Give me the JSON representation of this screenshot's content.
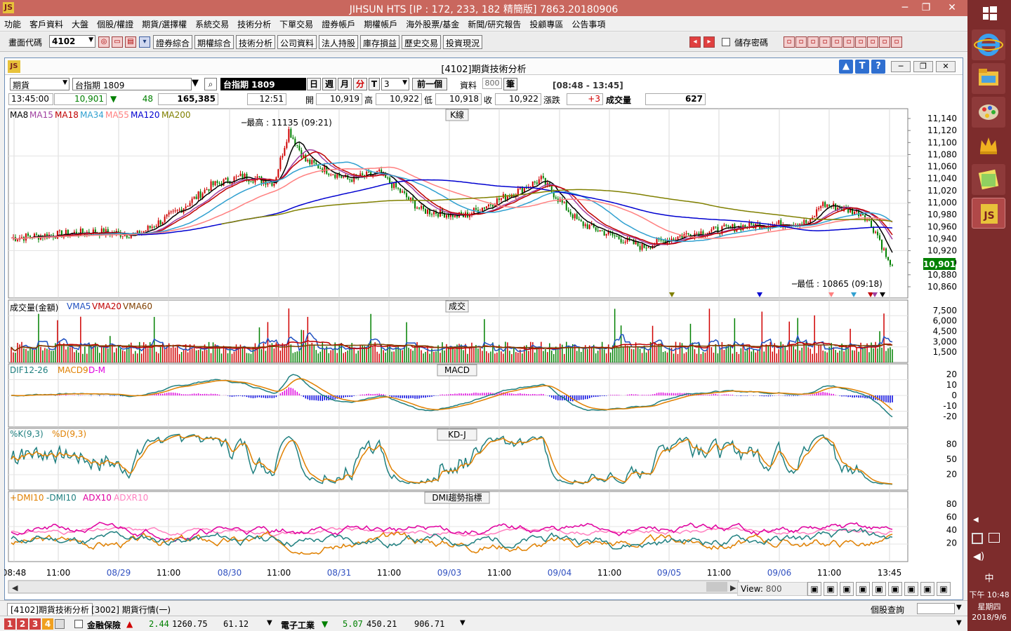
{
  "app": {
    "title": "JIHSUN HTS    [IP : 172, 233, 182 精簡版] 7863.20180906"
  },
  "menu": [
    "功能",
    "客戶資料",
    "大盤",
    "個股/權證",
    "期貨/選擇權",
    "系統交易",
    "技術分析",
    "下單交易",
    "證券帳戶",
    "期權帳戶",
    "海外股票/基金",
    "新聞/研究報告",
    "投顧專區",
    "公告事項"
  ],
  "toolbar": {
    "code_label": "畫面代碼",
    "code_value": "4102",
    "buttons": [
      "證券綜合",
      "期權綜合",
      "技術分析",
      "公司資料",
      "法人持股",
      "庫存損益",
      "歷史交易",
      "投資現況"
    ],
    "save_pwd": "儲存密碼"
  },
  "chart_window": {
    "title": "[4102]期貨技術分析",
    "btn_up": "▲",
    "btn_t": "T",
    "btn_help": "?"
  },
  "controls": {
    "market": "期貨",
    "contract": "台指期 1809",
    "contract_name": "台指期 1809",
    "period_day": "日",
    "period_week": "週",
    "period_month": "月",
    "period_min": "分",
    "period_t": "T",
    "interval": "3",
    "prev": "前一個",
    "data_label": "資料",
    "data_count": "800",
    "data_unit": "筆",
    "session": "[08:48 - 13:45]"
  },
  "quote": {
    "time": "13:45:00",
    "price": "10,901",
    "change_arrow": "▼",
    "change": "48",
    "volume_amt": "165,385",
    "tick_time": "12:51",
    "open_label": "開",
    "open": "10,919",
    "high_label": "高",
    "high": "10,922",
    "low_label": "低",
    "low": "10,918",
    "close_label": "收",
    "close": "10,922",
    "chg_label": "漲跌",
    "chg": "+3",
    "vol_label": "成交量",
    "vol": "627"
  },
  "panels": {
    "kline": {
      "name": "K線",
      "legend": [
        "MA8",
        "MA15",
        "MA18",
        "MA34",
        "MA55",
        "MA120",
        "MA200"
      ],
      "legend_colors": [
        "#000000",
        "#a040a0",
        "#c00000",
        "#30a0d0",
        "#ff8080",
        "#0000d0",
        "#808000"
      ],
      "ticks": [
        "11,140",
        "11,120",
        "11,100",
        "11,080",
        "11,060",
        "11,040",
        "11,020",
        "11,000",
        "10,980",
        "10,960",
        "10,940",
        "10,920",
        "10,900",
        "10,880",
        "10,860"
      ],
      "high_note": "最高 : 11135 (09:21)",
      "low_note": "最低 : 10865 (09:18)",
      "last_price": "10,901"
    },
    "volume": {
      "name": "成交",
      "legend": [
        "成交量(金額)",
        "VMA5",
        "VMA20",
        "VMA60"
      ],
      "legend_colors": [
        "#000000",
        "#2050c0",
        "#c00000",
        "#804000"
      ],
      "ticks": [
        "7,500",
        "6,000",
        "4,500",
        "3,000",
        "1,500"
      ]
    },
    "macd": {
      "name": "MACD",
      "legend": [
        "DIF12-26",
        "MACD9",
        "D-M"
      ],
      "legend_colors": [
        "#208080",
        "#e08000",
        "#e000e0"
      ],
      "ticks": [
        "20",
        "10",
        "0",
        "-10",
        "-20"
      ]
    },
    "kd": {
      "name": "KD-J",
      "legend": [
        "%K(9,3)",
        "%D(9,3)"
      ],
      "legend_colors": [
        "#208080",
        "#e08000"
      ],
      "ticks": [
        "80",
        "50",
        "20"
      ]
    },
    "dmi": {
      "name": "DMI趨勢指標",
      "legend": [
        "+DMI10",
        "-DMI10",
        "ADX10",
        "ADXR10"
      ],
      "legend_colors": [
        "#e08000",
        "#208080",
        "#e000a0",
        "#ff80c0"
      ],
      "ticks": [
        "80",
        "60",
        "40",
        "20"
      ]
    }
  },
  "xaxis": [
    "08:48",
    "11:00",
    "08/29",
    "11:00",
    "08/30",
    "11:00",
    "08/31",
    "11:00",
    "09/03",
    "11:00",
    "09/04",
    "11:00",
    "09/05",
    "11:00",
    "09/06",
    "11:00",
    "13:45"
  ],
  "view": {
    "label": "View:",
    "value": "800"
  },
  "tabs": [
    "[4102]期貨技術分析",
    "[3002] 期貨行情(一)"
  ],
  "status_right": "個股查詢",
  "bottom": {
    "nums": [
      "1",
      "2",
      "3",
      "4"
    ],
    "ind1_name": "金融保險",
    "ind1_chg": "2.44",
    "ind1_val": "1260.75",
    "ind1_amt": "61.12",
    "ind2_name": "電子工業",
    "ind2_chg": "5.07",
    "ind2_val": "450.21",
    "ind2_amt": "906.71"
  },
  "clock": {
    "ime": "中",
    "time": "下午 10:48",
    "weekday": "星期四",
    "date": "2018/9/6"
  }
}
